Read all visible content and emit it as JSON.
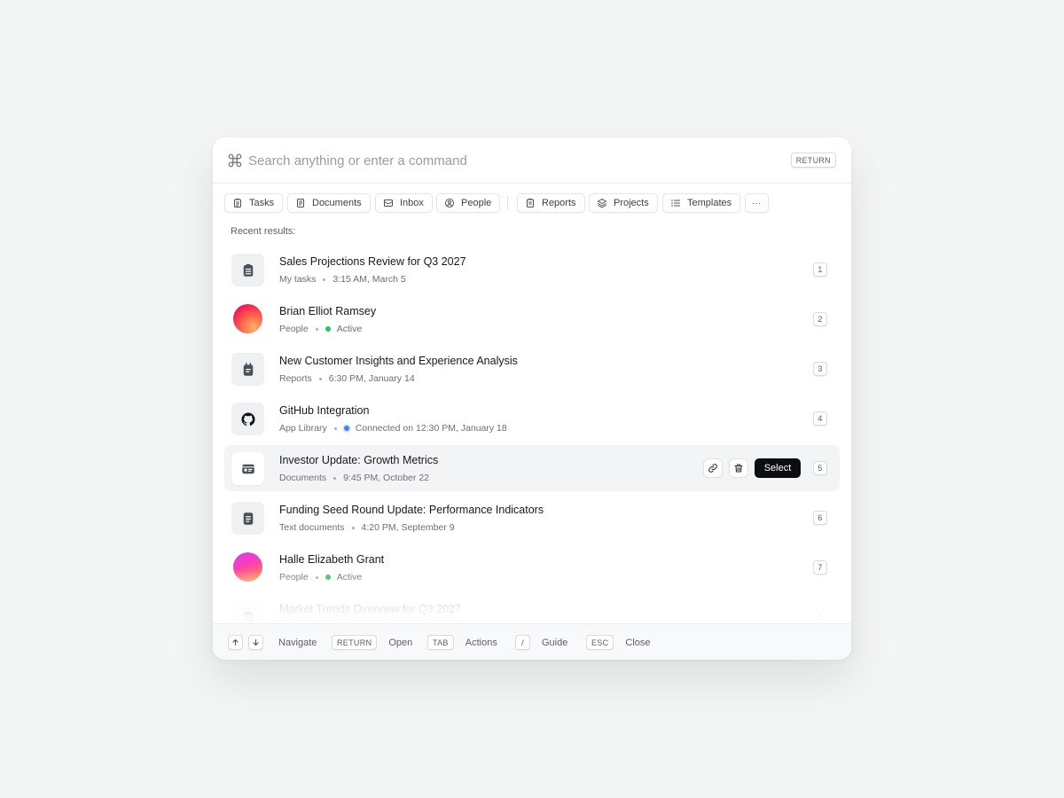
{
  "search": {
    "placeholder": "Search anything or enter a command",
    "return_key": "RETURN"
  },
  "filters": [
    {
      "label": "Tasks",
      "icon": "clipboard-icon"
    },
    {
      "label": "Documents",
      "icon": "document-icon"
    },
    {
      "label": "Inbox",
      "icon": "inbox-icon"
    },
    {
      "label": "People",
      "icon": "user-circle-icon"
    },
    {
      "label": "Reports",
      "icon": "report-icon"
    },
    {
      "label": "Projects",
      "icon": "layers-icon"
    },
    {
      "label": "Templates",
      "icon": "list-icon"
    },
    {
      "label": "···",
      "icon": "more-icon"
    }
  ],
  "recent_label": "Recent results:",
  "results": [
    {
      "title": "Sales Projections Review for Q3 2027",
      "category": "My tasks",
      "detail": "3:15 AM, March 5",
      "num": "1",
      "icon": "clipboard-list-icon"
    },
    {
      "title": "Brian Elliot Ramsey",
      "category": "People",
      "detail": "Active",
      "status_color": "#22c55e",
      "num": "2",
      "icon": "avatar"
    },
    {
      "title": "New Customer Insights and Experience Analysis",
      "category": "Reports",
      "detail": "6:30 PM, January 14",
      "num": "3",
      "icon": "calendar-report-icon"
    },
    {
      "title": "GitHub Integration",
      "category": "App Library",
      "detail": "Connected on 12:30 PM, January 18",
      "status_color": "#3b82f6",
      "num": "4",
      "icon": "github-icon"
    },
    {
      "title": "Investor Update: Growth Metrics",
      "category": "Documents",
      "detail": "9:45 PM, October 22",
      "num": "5",
      "icon": "id-card-icon",
      "selected": true,
      "select_label": "Select"
    },
    {
      "title": "Funding Seed Round Update: Performance Indicators",
      "category": "Text documents",
      "detail": "4:20 PM, September 9",
      "num": "6",
      "icon": "text-document-icon"
    },
    {
      "title": "Halle Elizabeth Grant",
      "category": "People",
      "detail": "Active",
      "status_color": "#22c55e",
      "num": "7",
      "icon": "avatar"
    },
    {
      "title": "Market Trends Overview for Q3 2027",
      "category": "",
      "detail": "",
      "num": "8",
      "icon": "document-icon"
    }
  ],
  "footer": {
    "navigate": "Navigate",
    "return_key": "RETURN",
    "open": "Open",
    "tab_key": "TAB",
    "actions": "Actions",
    "slash_key": "/",
    "guide": "Guide",
    "esc_key": "ESC",
    "close": "Close"
  },
  "colors": {
    "background": "#f4f5f5",
    "selected_row": "#f3f4f6",
    "select_button": "#0c0d10"
  }
}
